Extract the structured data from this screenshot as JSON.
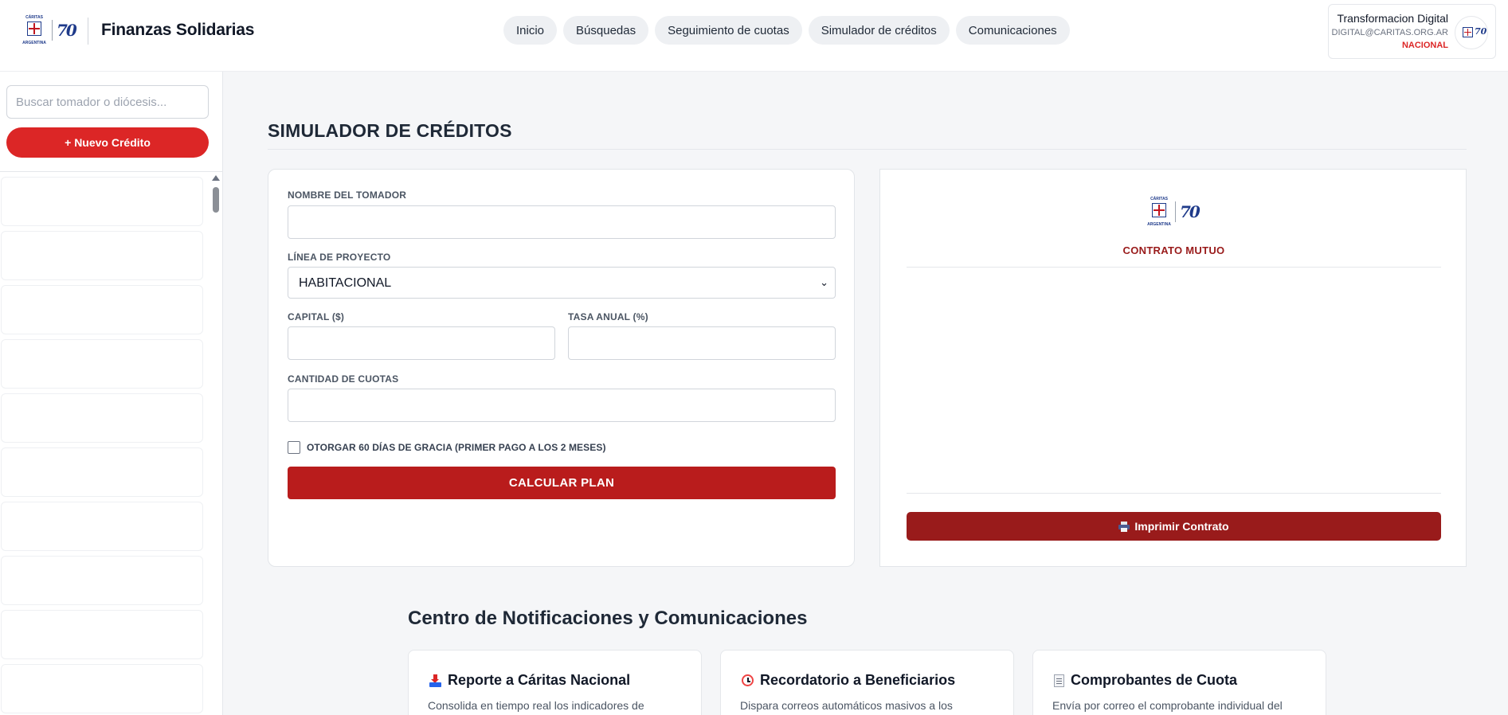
{
  "header": {
    "brand_top_text": "CÁRITAS",
    "brand_bottom_text": "ARGENTINA",
    "brand_badge": "70",
    "title": "Finanzas Solidarias",
    "nav": [
      {
        "label": "Inicio"
      },
      {
        "label": "Búsquedas"
      },
      {
        "label": "Seguimiento de cuotas"
      },
      {
        "label": "Simulador de créditos"
      },
      {
        "label": "Comunicaciones"
      }
    ],
    "user": {
      "name": "Transformacion Digital",
      "email": "DIGITAL@CARITAS.ORG.AR",
      "role": "NACIONAL"
    }
  },
  "sidebar": {
    "search_placeholder": "Buscar tomador o diócesis...",
    "new_credit_label": "+ Nuevo Crédito",
    "credit_items_count_visible": 10
  },
  "simulator": {
    "title": "SIMULADOR DE CRÉDITOS",
    "borrower_label": "NOMBRE DEL TOMADOR",
    "borrower_value": "",
    "project_line_label": "LÍNEA DE PROYECTO",
    "project_line_value": "HABITACIONAL",
    "capital_label": "CAPITAL ($)",
    "capital_value": "",
    "rate_label": "TASA ANUAL (%)",
    "rate_value": "",
    "installments_label": "CANTIDAD DE CUOTAS",
    "installments_value": "",
    "grace_label": "OTORGAR 60 DÍAS DE GRACIA (PRIMER PAGO A LOS 2 MESES)",
    "grace_checked": false,
    "calculate_label": "CALCULAR PLAN"
  },
  "contract": {
    "title": "CONTRATO MUTUO",
    "print_label": "Imprimir Contrato"
  },
  "notifications": {
    "title": "Centro de Notificaciones y Comunicaciones",
    "cards": [
      {
        "icon": "outbox-tray-icon",
        "title": "Reporte a Cáritas Nacional",
        "desc": "Consolida en tiempo real los indicadores de"
      },
      {
        "icon": "alarm-clock-icon",
        "title": "Recordatorio a Beneficiarios",
        "desc": "Dispara correos automáticos masivos a los"
      },
      {
        "icon": "receipt-icon",
        "title": "Comprobantes de Cuota",
        "desc": "Envía por correo el comprobante individual del"
      }
    ]
  },
  "colors": {
    "primary_red": "#dc2626",
    "dark_red": "#b91c1c",
    "contract_red": "#991b1b",
    "brand_blue": "#1e3a8a"
  }
}
